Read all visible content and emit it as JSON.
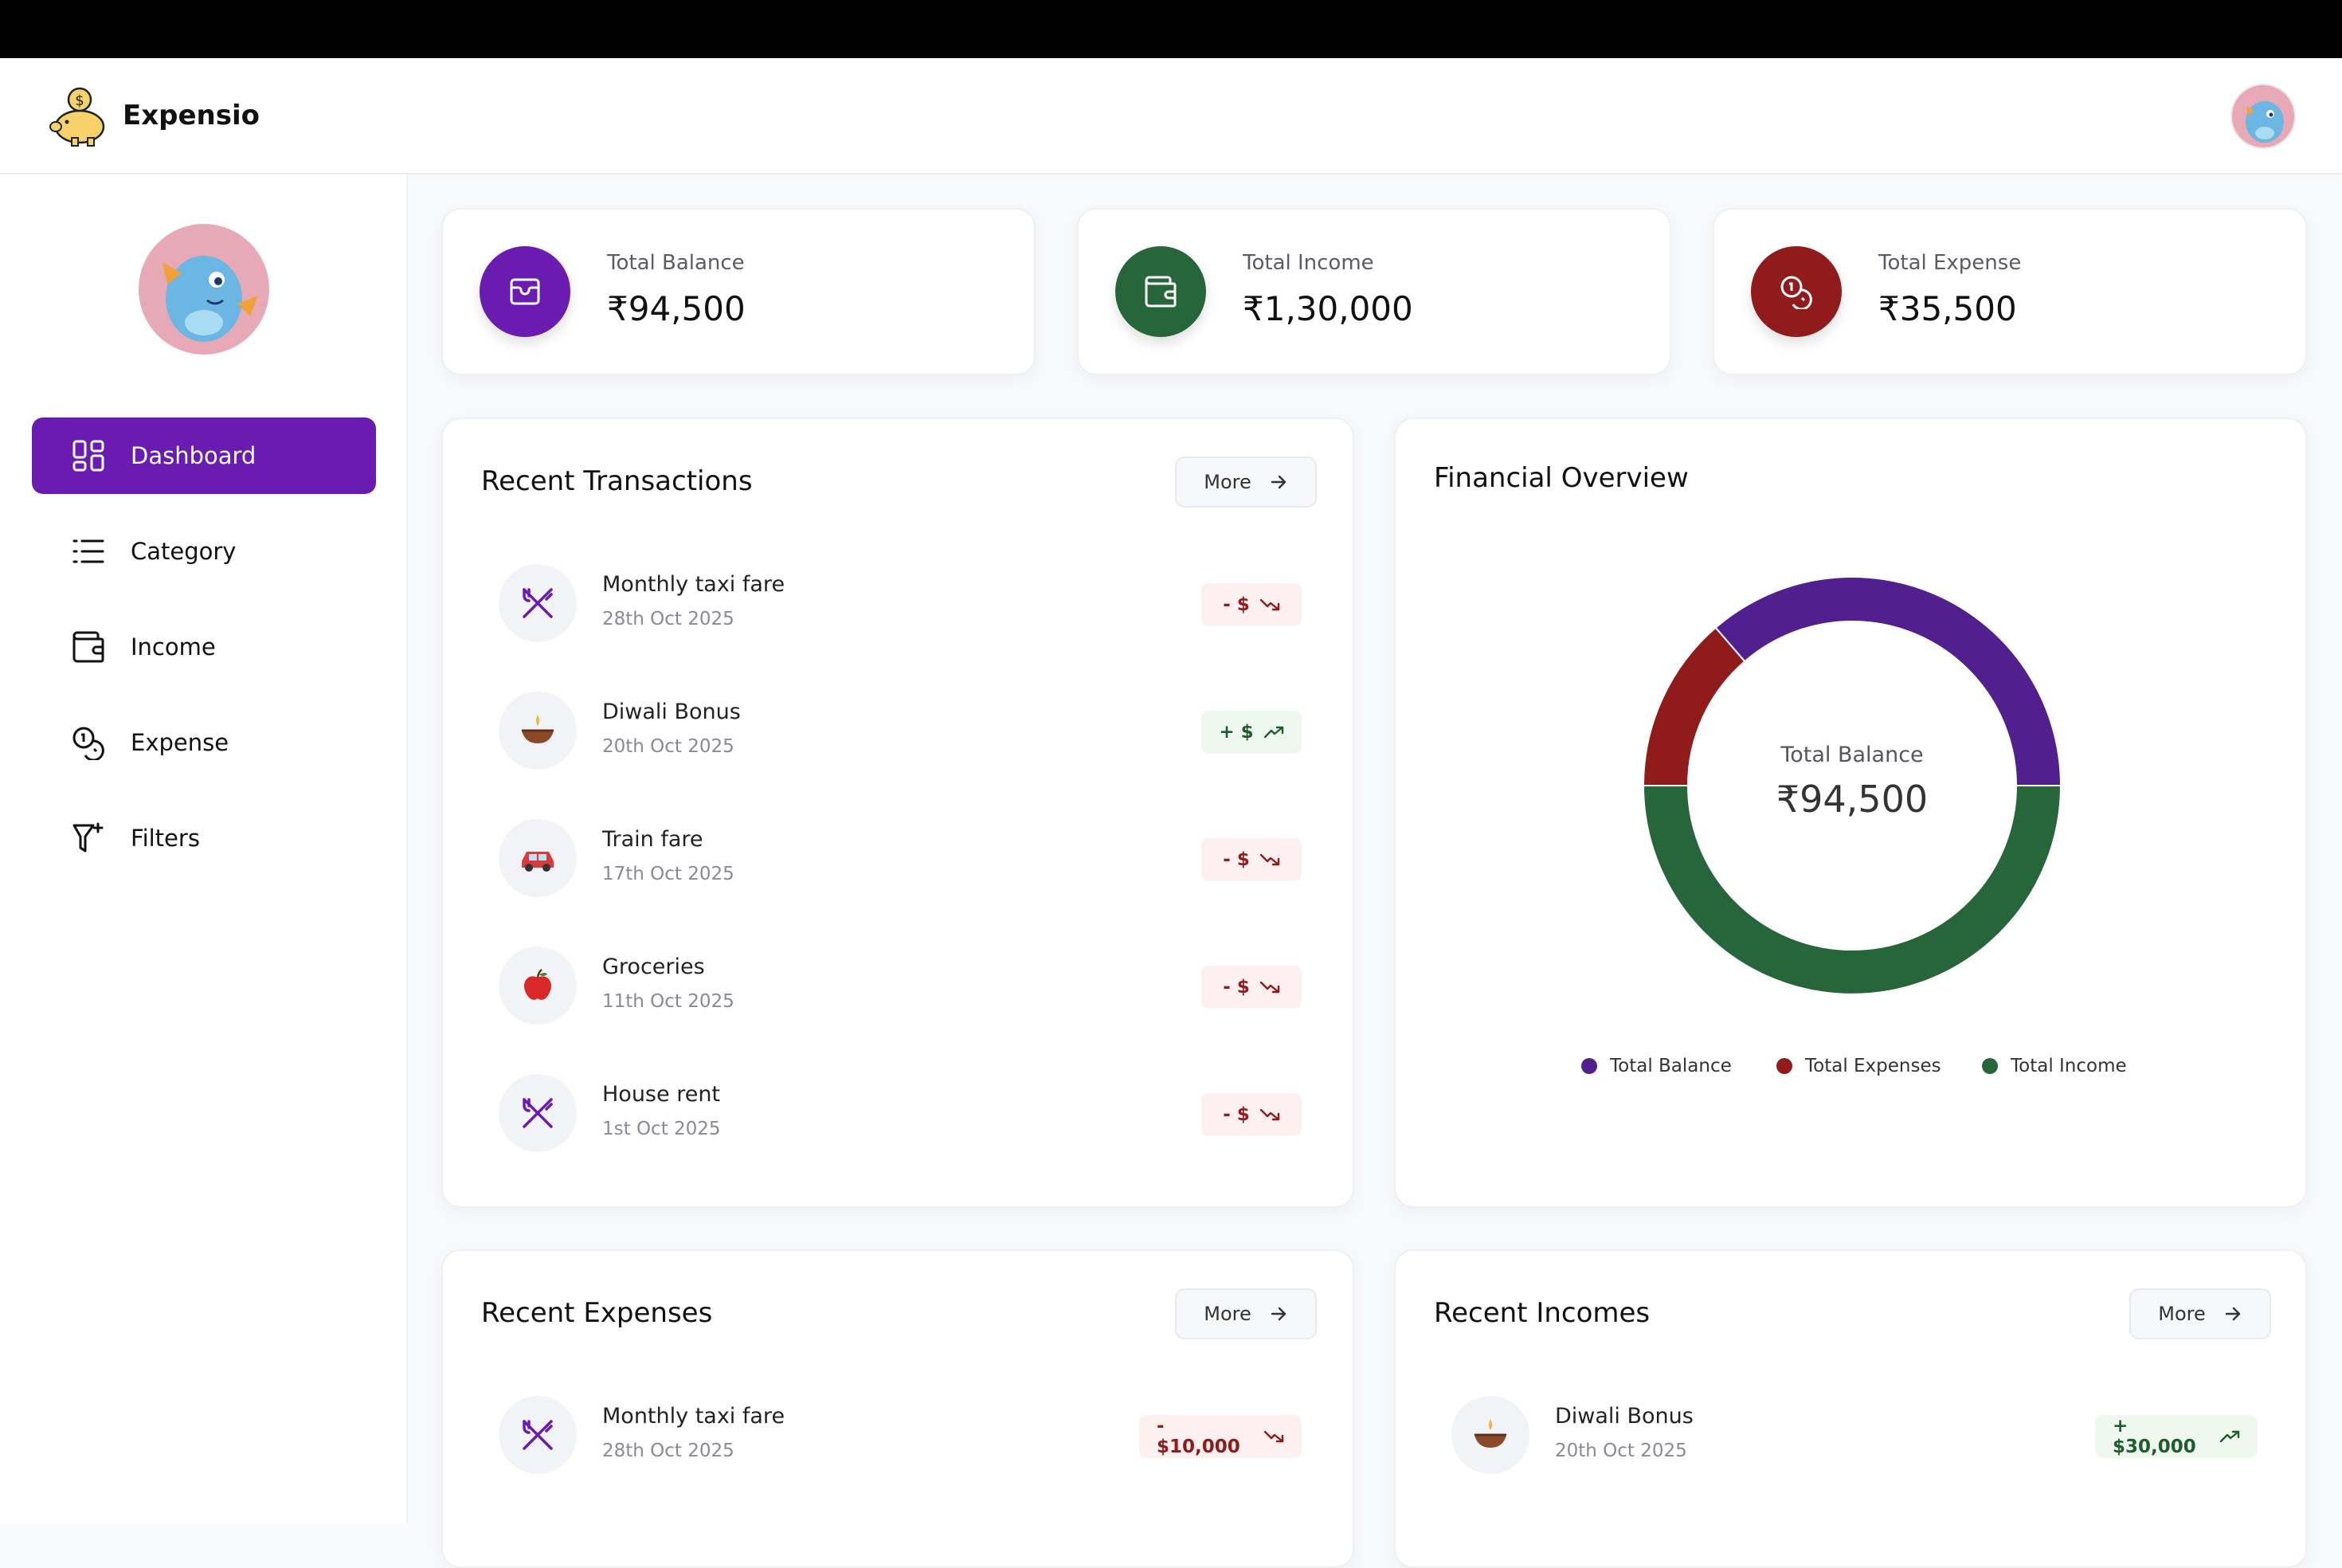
{
  "app": {
    "name": "Expensio"
  },
  "colors": {
    "accent": "#6a1bb0",
    "income": "#27663a",
    "expense": "#8f1b1b",
    "balance": "#521f8f"
  },
  "sidebar": {
    "items": [
      {
        "label": "Dashboard",
        "icon": "dashboard-grid-icon",
        "active": true
      },
      {
        "label": "Category",
        "icon": "list-icon"
      },
      {
        "label": "Income",
        "icon": "wallet-icon"
      },
      {
        "label": "Expense",
        "icon": "coins-icon"
      },
      {
        "label": "Filters",
        "icon": "filter-plus-icon"
      }
    ]
  },
  "stats": [
    {
      "label": "Total Balance",
      "value": "₹94,500",
      "icon": "wallet-card-icon",
      "color": "#6a1bb0"
    },
    {
      "label": "Total Income",
      "value": "₹1,30,000",
      "icon": "wallet-icon",
      "color": "#27663a"
    },
    {
      "label": "Total Expense",
      "value": "₹35,500",
      "icon": "coins-icon",
      "color": "#8f1b1b"
    }
  ],
  "recent_transactions": {
    "title": "Recent Transactions",
    "more_label": "More",
    "items": [
      {
        "title": "Monthly taxi fare",
        "date": "28th Oct 2025",
        "amount": "- $",
        "type": "expense",
        "icon": "utensils-crossed-icon"
      },
      {
        "title": "Diwali Bonus",
        "date": "20th Oct 2025",
        "amount": "+ $",
        "type": "income",
        "icon": "diya-lamp-icon"
      },
      {
        "title": "Train fare",
        "date": "17th Oct 2025",
        "amount": "- $",
        "type": "expense",
        "icon": "car-icon"
      },
      {
        "title": "Groceries",
        "date": "11th Oct 2025",
        "amount": "- $",
        "type": "expense",
        "icon": "apple-icon"
      },
      {
        "title": "House rent",
        "date": "1st Oct 2025",
        "amount": "- $",
        "type": "expense",
        "icon": "utensils-crossed-icon"
      }
    ]
  },
  "financial_overview": {
    "title": "Financial Overview",
    "center_label": "Total Balance",
    "center_value": "₹94,500"
  },
  "chart_data": {
    "type": "pie",
    "donut": true,
    "categories": [
      "Total Balance",
      "Total Expenses",
      "Total Income"
    ],
    "values": [
      94500,
      35500,
      130000
    ],
    "colors": [
      "#521f8f",
      "#8f1b1b",
      "#27663a"
    ],
    "legend": "bottom"
  },
  "recent_expenses": {
    "title": "Recent Expenses",
    "more_label": "More",
    "items": [
      {
        "title": "Monthly taxi fare",
        "date": "28th Oct 2025",
        "amount": "- $10,000",
        "type": "expense",
        "icon": "utensils-crossed-icon"
      }
    ]
  },
  "recent_incomes": {
    "title": "Recent Incomes",
    "more_label": "More",
    "items": [
      {
        "title": "Diwali Bonus",
        "date": "20th Oct 2025",
        "amount": "+ $30,000",
        "type": "income",
        "icon": "diya-lamp-icon"
      }
    ]
  }
}
